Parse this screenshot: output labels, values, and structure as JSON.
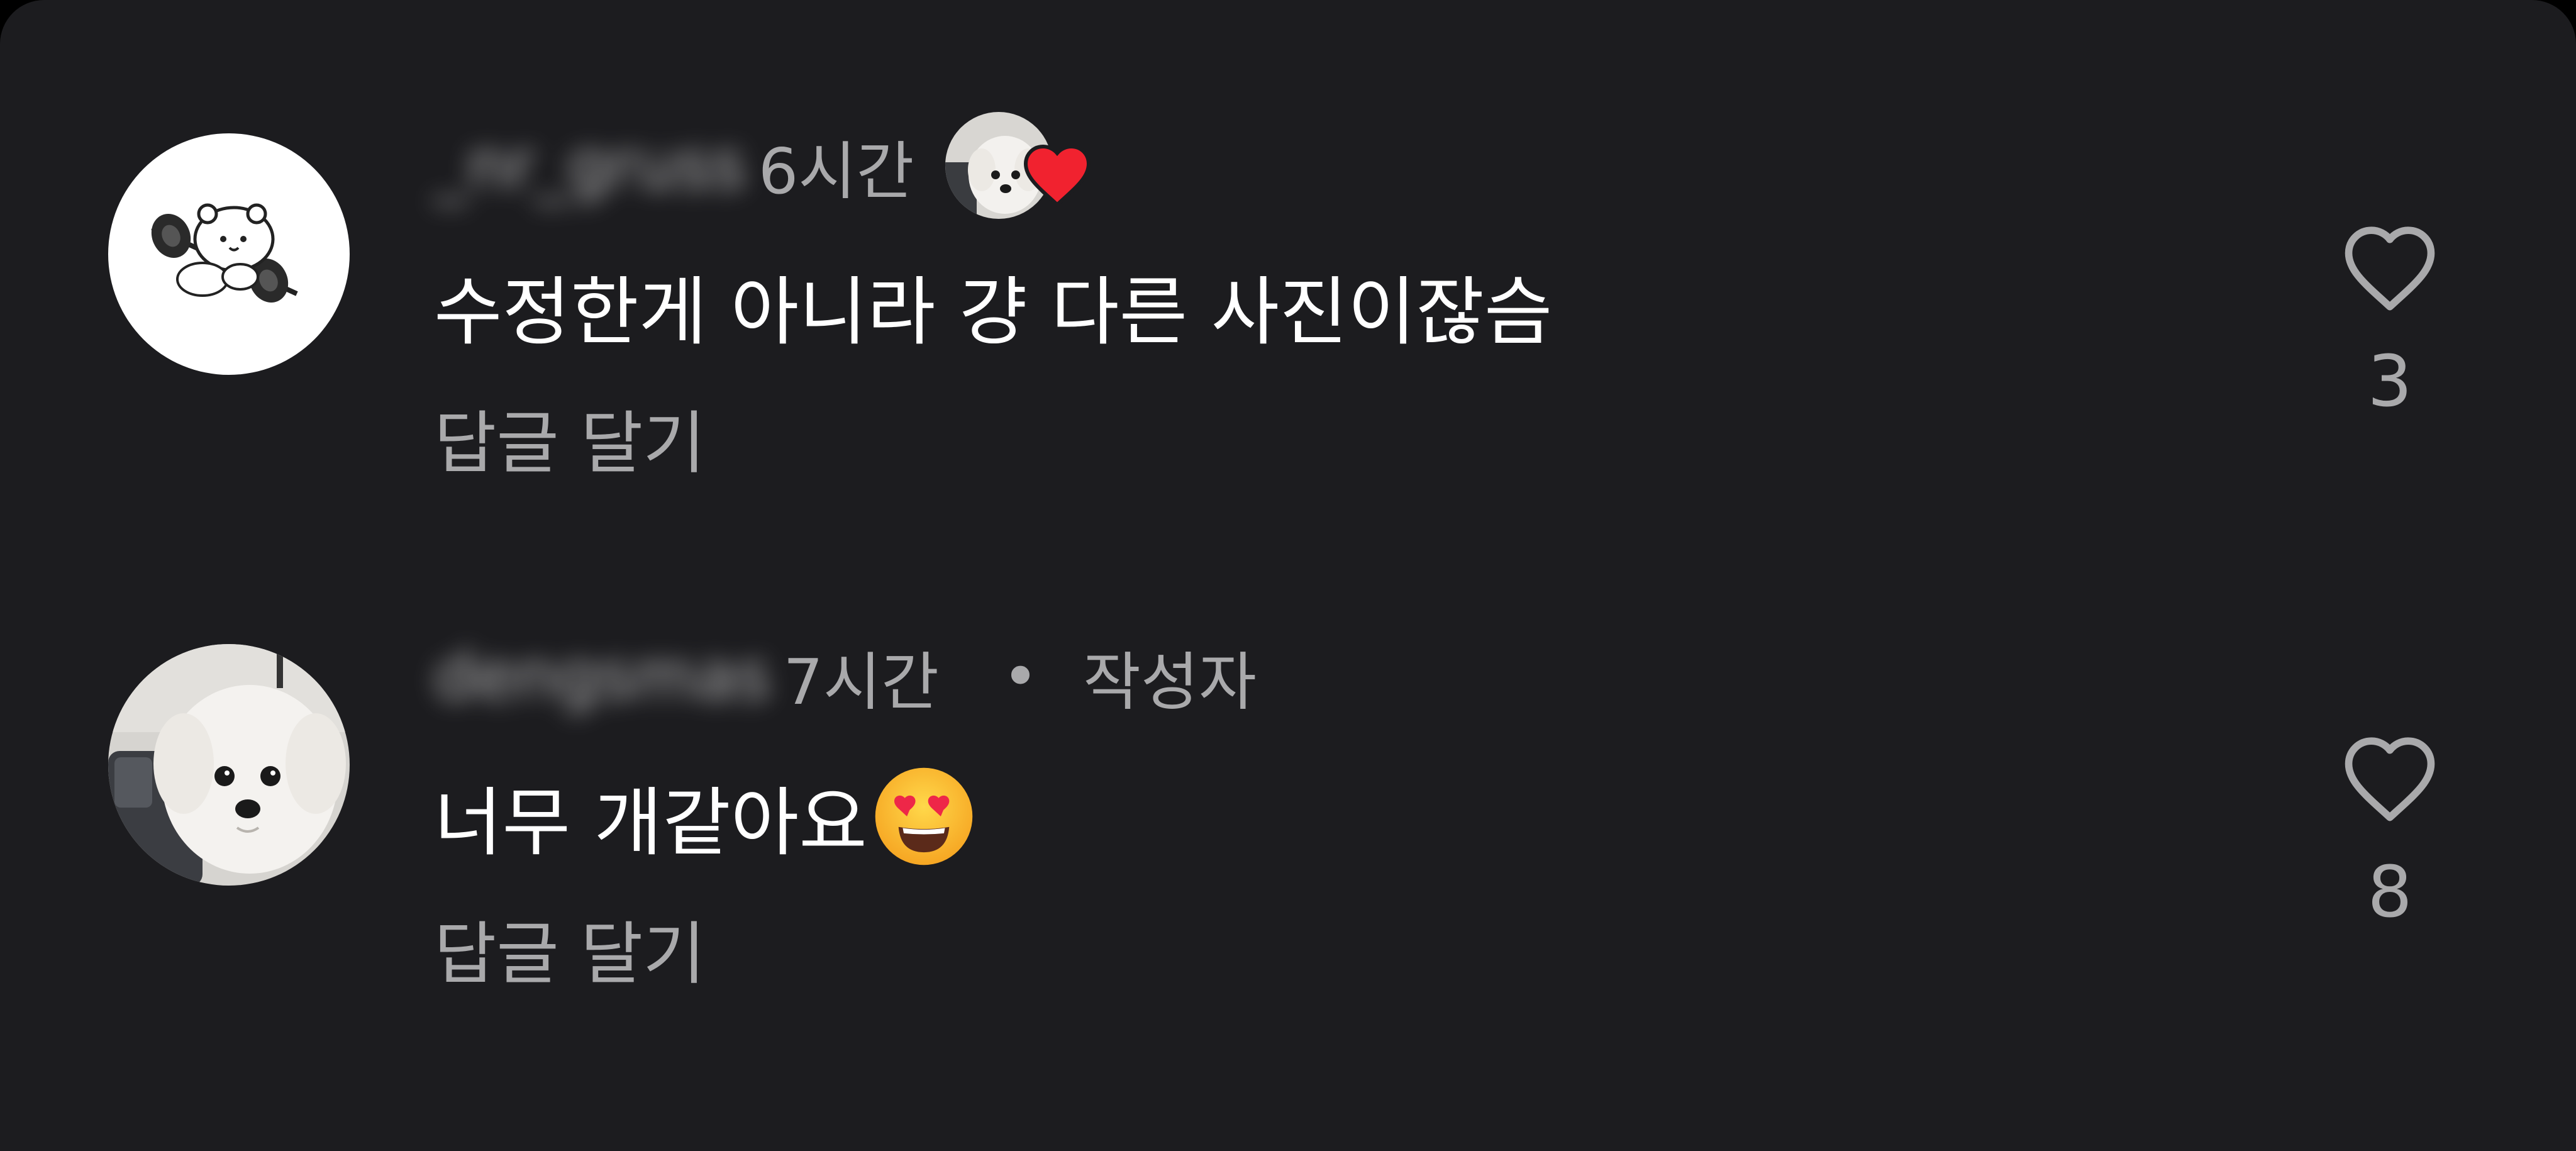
{
  "comments": [
    {
      "username": "_nr_gruss",
      "time": "6시간",
      "text": "수정한게 아니라 걍 다른 사진이잖슴",
      "reply_label": "답글 달기",
      "like_count": "3",
      "avatar": "barbell-character-avatar",
      "author_liked": true
    },
    {
      "username": "dengsmas",
      "time": "7시간",
      "separator": "•",
      "author_tag": "작성자",
      "text": "너무 개같아요",
      "emoji": "heart-eyes-emoji",
      "reply_label": "답글 달기",
      "like_count": "8",
      "avatar": "white-dog-avatar"
    }
  ],
  "colors": {
    "background": "#1c1c1f",
    "primary_text": "#ffffff",
    "secondary_text": "#a9a9ab",
    "heart_red": "#f1222f"
  }
}
